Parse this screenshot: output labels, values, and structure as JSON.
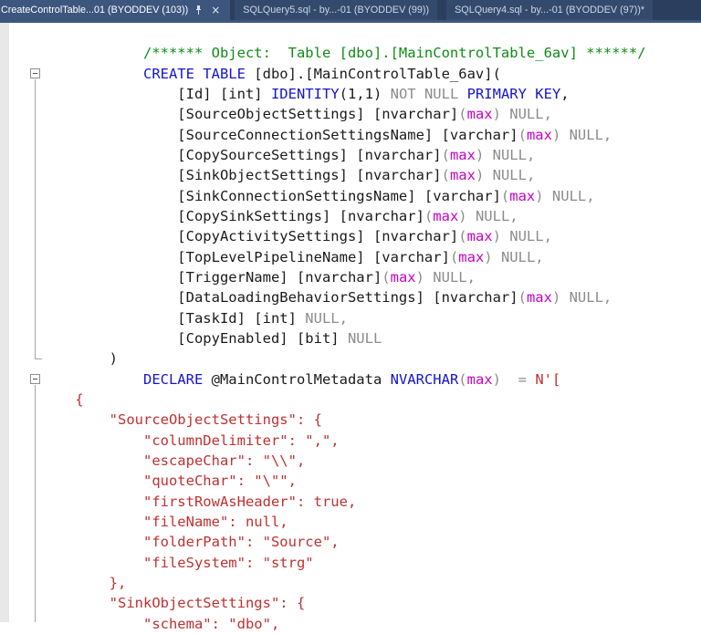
{
  "tab_bar": {
    "tabs": [
      {
        "label": "CreateControlTable...01 (BYODDEV (103))",
        "active": true,
        "pinned": true
      },
      {
        "label": "SQLQuery5.sql - by...-01 (BYODDEV (99))",
        "active": false
      },
      {
        "label": "SQLQuery4.sql - by...-01 (BYODDEV (97))*",
        "active": false
      }
    ],
    "close_glyph": "×"
  },
  "colors": {
    "tabbar_bg": "#2b3e5e",
    "tab_active_bg": "#3d567e",
    "tab_inactive_bg": "#344a6d",
    "keyword_blue": "#1515d0",
    "comment_green": "#0e8c17",
    "string_red": "#c03030",
    "system_gray": "#8c8c8c",
    "function_magenta": "#c800c8"
  },
  "editor": {
    "code_lines": [
      [],
      [
        [
          "cm",
          "            /****** Object:  Table [dbo].[MainControlTable_6av] ******/"
        ]
      ],
      [
        [
          "id",
          "            "
        ],
        [
          "kw",
          "CREATE TABLE"
        ],
        [
          "id",
          " [dbo].[MainControlTable_6av]("
        ]
      ],
      [
        [
          "id",
          "                [Id] [int] "
        ],
        [
          "kw",
          "IDENTITY"
        ],
        [
          "id",
          "(1,1) "
        ],
        [
          "gr",
          "NOT NULL "
        ],
        [
          "kw",
          "PRIMARY KEY"
        ],
        [
          "id",
          ","
        ]
      ],
      [
        [
          "id",
          "                [SourceObjectSettings] [nvarchar]"
        ],
        [
          "gr",
          "("
        ],
        [
          "mg",
          "max"
        ],
        [
          "gr",
          ") NULL,"
        ]
      ],
      [
        [
          "id",
          "                [SourceConnectionSettingsName] [varchar]"
        ],
        [
          "gr",
          "("
        ],
        [
          "mg",
          "max"
        ],
        [
          "gr",
          ") NULL,"
        ]
      ],
      [
        [
          "id",
          "                [CopySourceSettings] [nvarchar]"
        ],
        [
          "gr",
          "("
        ],
        [
          "mg",
          "max"
        ],
        [
          "gr",
          ") NULL,"
        ]
      ],
      [
        [
          "id",
          "                [SinkObjectSettings] [nvarchar]"
        ],
        [
          "gr",
          "("
        ],
        [
          "mg",
          "max"
        ],
        [
          "gr",
          ") NULL,"
        ]
      ],
      [
        [
          "id",
          "                [SinkConnectionSettingsName] [varchar]"
        ],
        [
          "gr",
          "("
        ],
        [
          "mg",
          "max"
        ],
        [
          "gr",
          ") NULL,"
        ]
      ],
      [
        [
          "id",
          "                [CopySinkSettings] [nvarchar]"
        ],
        [
          "gr",
          "("
        ],
        [
          "mg",
          "max"
        ],
        [
          "gr",
          ") NULL,"
        ]
      ],
      [
        [
          "id",
          "                [CopyActivitySettings] [nvarchar]"
        ],
        [
          "gr",
          "("
        ],
        [
          "mg",
          "max"
        ],
        [
          "gr",
          ") NULL,"
        ]
      ],
      [
        [
          "id",
          "                [TopLevelPipelineName] [varchar]"
        ],
        [
          "gr",
          "("
        ],
        [
          "mg",
          "max"
        ],
        [
          "gr",
          ") NULL,"
        ]
      ],
      [
        [
          "id",
          "                [TriggerName] [nvarchar]"
        ],
        [
          "gr",
          "("
        ],
        [
          "mg",
          "max"
        ],
        [
          "gr",
          ") NULL,"
        ]
      ],
      [
        [
          "id",
          "                [DataLoadingBehaviorSettings] [nvarchar]"
        ],
        [
          "gr",
          "("
        ],
        [
          "mg",
          "max"
        ],
        [
          "gr",
          ") NULL,"
        ]
      ],
      [
        [
          "id",
          "                [TaskId] [int] "
        ],
        [
          "gr",
          "NULL,"
        ]
      ],
      [
        [
          "id",
          "                [CopyEnabled] [bit] "
        ],
        [
          "gr",
          "NULL"
        ]
      ],
      [
        [
          "id",
          "        )"
        ]
      ],
      [
        [
          "id",
          "            "
        ],
        [
          "kw",
          "DECLARE"
        ],
        [
          "id",
          " @MainControlMetadata "
        ],
        [
          "kw",
          "NVARCHAR"
        ],
        [
          "gr",
          "("
        ],
        [
          "mg",
          "max"
        ],
        [
          "gr",
          ")"
        ],
        [
          "id",
          "  "
        ],
        [
          "gr",
          "= "
        ],
        [
          "str",
          "N'["
        ]
      ],
      [
        [
          "str",
          "    {"
        ]
      ],
      [
        [
          "str",
          "        \"SourceObjectSettings\": {"
        ]
      ],
      [
        [
          "str",
          "            \"columnDelimiter\": \",\","
        ]
      ],
      [
        [
          "str",
          "            \"escapeChar\": \"\\\\\","
        ]
      ],
      [
        [
          "str",
          "            \"quoteChar\": \"\\\"\","
        ]
      ],
      [
        [
          "str",
          "            \"firstRowAsHeader\": true,"
        ]
      ],
      [
        [
          "str",
          "            \"fileName\": null,"
        ]
      ],
      [
        [
          "str",
          "            \"folderPath\": \"Source\","
        ]
      ],
      [
        [
          "str",
          "            \"fileSystem\": \"strg\""
        ]
      ],
      [
        [
          "str",
          "        },"
        ]
      ],
      [
        [
          "str",
          "        \"SinkObjectSettings\": {"
        ]
      ],
      [
        [
          "str",
          "            \"schema\": \"dbo\","
        ]
      ]
    ]
  }
}
